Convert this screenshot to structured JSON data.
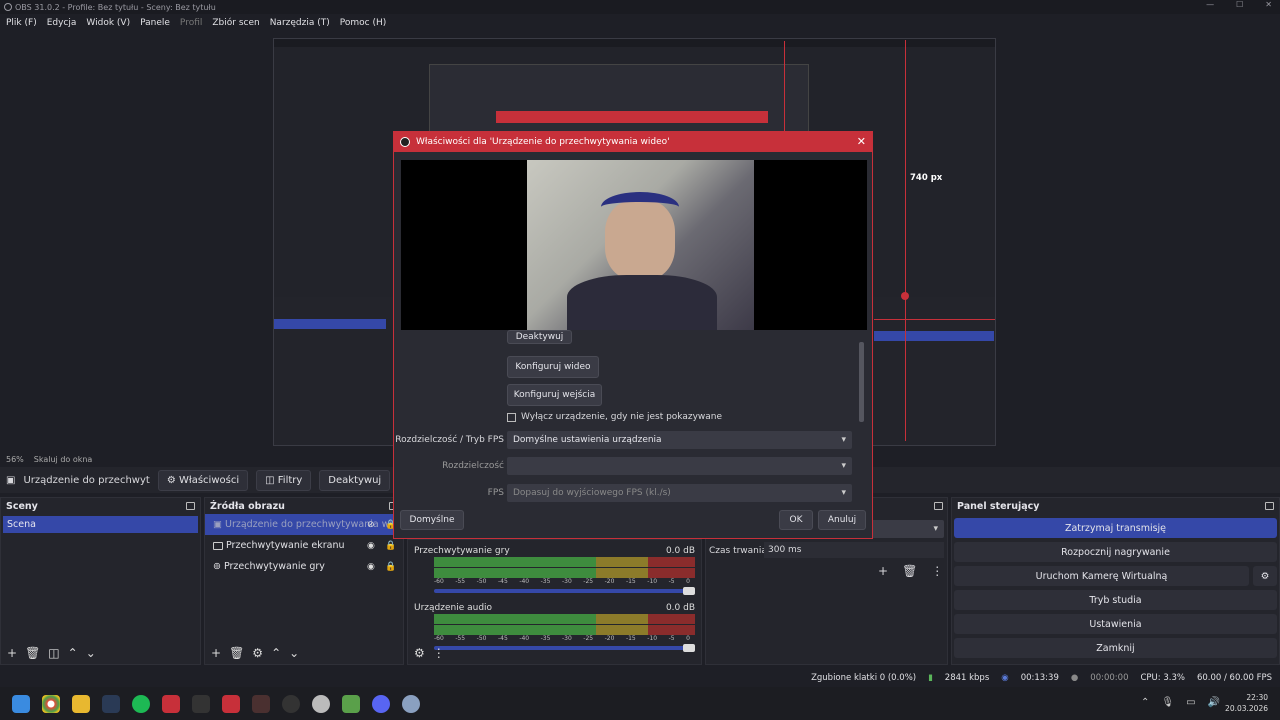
{
  "window": {
    "title": "OBS 31.0.2 - Profile: Bez tytułu - Sceny: Bez tytułu"
  },
  "menu": [
    "Plik (F)",
    "Edycja",
    "Widok (V)",
    "Panele",
    "Profil",
    "Zbiór scen",
    "Narzędzia (T)",
    "Pomoc (H)"
  ],
  "preview": {
    "measure": "740 px"
  },
  "zoom": {
    "percent": "56%",
    "fit": "Skaluj do okna"
  },
  "source_toolbar": {
    "current": "Urządzenie do przechwyt",
    "properties": "Właściwości",
    "filters": "Filtry",
    "deactivate": "Deaktywuj"
  },
  "scenes": {
    "title": "Sceny",
    "items": [
      "Scena"
    ]
  },
  "sources": {
    "title": "Źródła obrazu",
    "items": [
      "Urządzenie do przechwytywania wi",
      "Przechwytywanie ekranu",
      "Przechwytywanie gry"
    ]
  },
  "mixer": {
    "channels": [
      {
        "name": "Przechwytywanie gry",
        "db": "0.0 dB"
      },
      {
        "name": "Urządzenie audio",
        "db": "0.0 dB"
      }
    ],
    "scale": [
      "-60",
      "-55",
      "-50",
      "-45",
      "-40",
      "-35",
      "-30",
      "-25",
      "-20",
      "-15",
      "-10",
      "-5",
      "0"
    ]
  },
  "transitions": {
    "duration_label": "Czas trwania",
    "duration": "300 ms"
  },
  "controls": {
    "title": "Panel sterujący",
    "stop_stream": "Zatrzymaj transmisję",
    "start_record": "Rozpocznij nagrywanie",
    "virtual_cam": "Uruchom Kamerę Wirtualną",
    "studio": "Tryb studia",
    "settings": "Ustawienia",
    "exit": "Zamknij"
  },
  "status": {
    "dropped": "Zgubione klatki 0 (0.0%)",
    "bitrate": "2841 kbps",
    "stream_time": "00:13:39",
    "rec_time": "00:00:00",
    "cpu": "CPU: 3.3%",
    "fps": "60.00 / 60.00 FPS"
  },
  "clock": {
    "time": "22:30",
    "date": "20.03.2026"
  },
  "dialog": {
    "title": "Właściwości dla 'Urządzenie do przechwytywania wideo'",
    "deactivate": "Deaktywuj",
    "config_video": "Konfiguruj wideo",
    "config_input": "Konfiguruj wejścia",
    "disable_hidden": "Wyłącz urządzenie, gdy nie jest pokazywane",
    "res_fps_label": "Rozdzielczość / Tryb FPS",
    "res_fps_value": "Domyślne ustawienia urządzenia",
    "res_label": "Rozdzielczość",
    "res_value": "",
    "fps_label": "FPS",
    "fps_value": "Dopasuj do wyjściowego FPS (kl./s)",
    "defaults": "Domyślne",
    "ok": "OK",
    "cancel": "Anuluj"
  }
}
